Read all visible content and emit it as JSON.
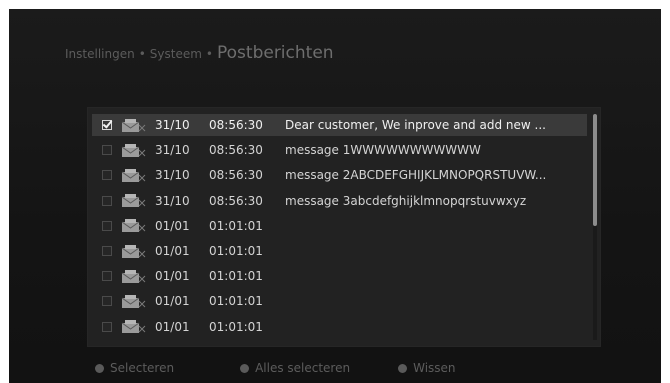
{
  "breadcrumb": {
    "level1": "Instellingen",
    "separator1": "•",
    "level2": "Systeem",
    "separator2": "•",
    "current": "Postberichten"
  },
  "messages": [
    {
      "checked": true,
      "icon": "mail-icon",
      "date": "31/10",
      "time": "08:56:30",
      "text": "Dear customer, We inprove and add new ..."
    },
    {
      "checked": false,
      "icon": "mail-icon",
      "date": "31/10",
      "time": "08:56:30",
      "text": "message 1WWWWWWWWWWW"
    },
    {
      "checked": false,
      "icon": "mail-icon",
      "date": "31/10",
      "time": "08:56:30",
      "text": "message 2ABCDEFGHIJKLMNOPQRSTUVW..."
    },
    {
      "checked": false,
      "icon": "mail-icon",
      "date": "31/10",
      "time": "08:56:30",
      "text": "message 3abcdefghijklmnopqrstuvwxyz"
    },
    {
      "checked": false,
      "icon": "mail-icon",
      "date": "01/01",
      "time": "01:01:01",
      "text": ""
    },
    {
      "checked": false,
      "icon": "mail-icon",
      "date": "01/01",
      "time": "01:01:01",
      "text": ""
    },
    {
      "checked": false,
      "icon": "mail-icon",
      "date": "01/01",
      "time": "01:01:01",
      "text": ""
    },
    {
      "checked": false,
      "icon": "mail-icon",
      "date": "01/01",
      "time": "01:01:01",
      "text": ""
    },
    {
      "checked": false,
      "icon": "mail-icon",
      "date": "01/01",
      "time": "01:01:01",
      "text": ""
    }
  ],
  "footer": {
    "select_label": "Selecteren",
    "select_all_label": "Alles selecteren",
    "delete_label": "Wissen"
  },
  "colors": {
    "background": "#141414",
    "selected_row": "#3a3a3a",
    "text": "#d4d4d4",
    "dim_text": "#5c5c5c"
  }
}
